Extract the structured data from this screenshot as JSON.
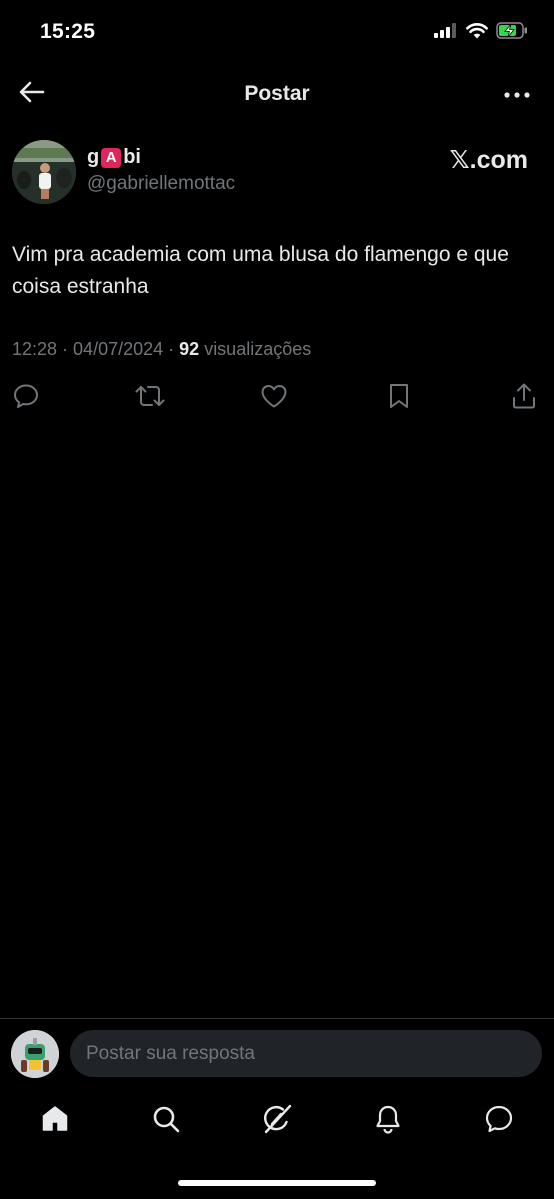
{
  "status_bar": {
    "time": "15:25",
    "icons": [
      "signal-icon",
      "wifi-icon",
      "battery-charging-icon"
    ]
  },
  "header": {
    "title": "Postar",
    "icons": [
      "back-arrow-icon",
      "more-icon"
    ]
  },
  "post": {
    "author": {
      "name_prefix": "g",
      "name_badge": "A",
      "name_suffix": "bi",
      "handle": "@gabriellemottac"
    },
    "source_label": "𝕏.com",
    "text": "Vim pra academia com uma blusa do flamengo e que coisa estranha",
    "time": "12:28",
    "date": "04/07/2024",
    "views_count": "92",
    "views_label": "visualizações",
    "actions": [
      "reply-icon",
      "repost-icon",
      "like-icon",
      "bookmark-icon",
      "share-icon"
    ]
  },
  "reply_bar": {
    "placeholder": "Postar sua resposta"
  },
  "bottom_nav": [
    "home-icon",
    "search-icon",
    "grok-icon",
    "notifications-icon",
    "messages-icon"
  ],
  "colors": {
    "background": "#000000",
    "text_primary": "#e7e9ea",
    "text_secondary": "#71767b",
    "divider": "#2f3336",
    "input_bg": "#202327",
    "battery_green": "#32d74b",
    "badge_red": "#e0245e"
  }
}
